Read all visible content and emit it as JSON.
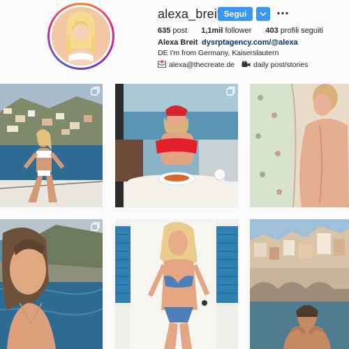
{
  "profile": {
    "username": "alexa_breit",
    "follow_label": "Segui",
    "stats": {
      "posts_value": "635",
      "posts_label": "post",
      "followers_value": "1,1mil",
      "followers_label": "follower",
      "following_value": "403",
      "following_label": "profili seguiti"
    },
    "full_name": "Alexa Breit",
    "bio_link": "dysrptagency.com/@alexa",
    "bio_line1": "DE I'm from Germany, Kaiserslautern",
    "email": "alexa@thecreate.de",
    "daily": "daily post/stories"
  },
  "icons": {
    "dropdown": "chevron-down-icon",
    "more": "more-dots-icon",
    "email": "inbox-icon",
    "camera": "movie-camera-icon",
    "multi": "carousel-icon"
  },
  "colors": {
    "accent": "#3897f0",
    "link": "#003569",
    "background": "#fafafa"
  },
  "posts": [
    {
      "id": "post-1",
      "scene": "boat-coastal-town",
      "multi": true
    },
    {
      "id": "post-2",
      "scene": "red-top-dining",
      "multi": true
    },
    {
      "id": "post-3",
      "scene": "curtain-portrait",
      "multi": false
    },
    {
      "id": "post-4",
      "scene": "sea-closeup",
      "multi": true
    },
    {
      "id": "post-5",
      "scene": "blue-shutters-bikini",
      "multi": false
    },
    {
      "id": "post-6",
      "scene": "coastal-village-water",
      "multi": false
    }
  ]
}
